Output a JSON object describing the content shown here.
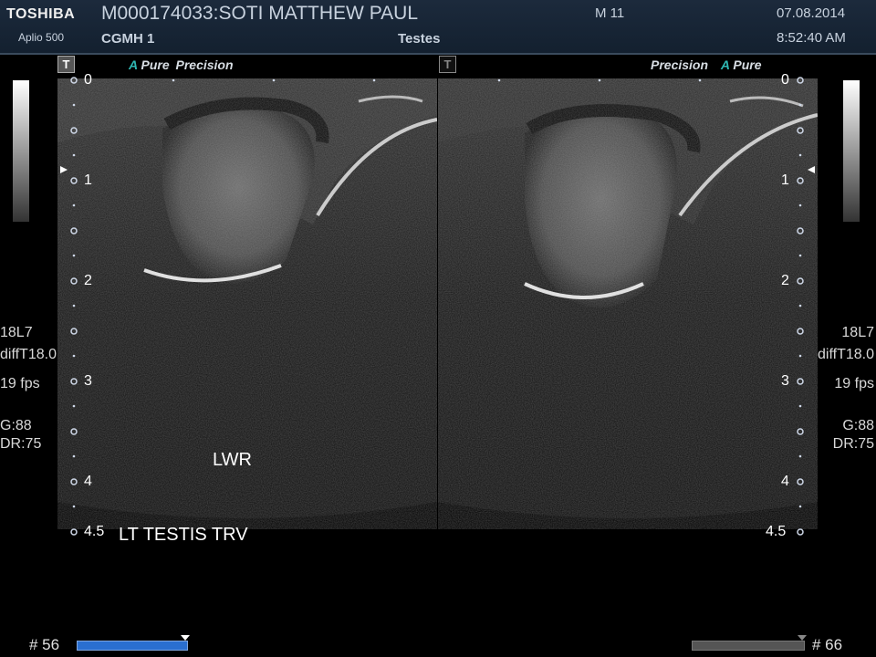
{
  "header": {
    "brand": "TOSHIBA",
    "model": "Aplio 500",
    "patient": "M000174033:SOTI MATTHEW PAUL",
    "hospital": "CGMH 1",
    "exam": "Testes",
    "mode_m": "M 11",
    "date": "07.08.2014",
    "time": "8:52:40 AM"
  },
  "left_panel": {
    "t_label": "T",
    "mode_a": "A",
    "mode_pure": "Pure",
    "mode_precision": "Precision",
    "depth_labels": [
      "0",
      "1",
      "2",
      "3",
      "4",
      "4.5"
    ],
    "annotation_lwr": "LWR",
    "annotation_title": "LT TESTIS TRV",
    "frame": "# 56",
    "cine_progress": 1.0
  },
  "right_panel": {
    "t_label": "T",
    "mode_precision": "Precision",
    "mode_a": "A",
    "mode_pure": "Pure",
    "depth_labels": [
      "0",
      "1",
      "2",
      "3",
      "4",
      "4.5"
    ],
    "frame": "# 66",
    "cine_progress": 1.0
  },
  "params_left": {
    "probe": "18L7",
    "filter": "diffT18.0",
    "fps": "19 fps",
    "gain": "G:88",
    "dr": "DR:75"
  },
  "params_right": {
    "probe": "18L7",
    "filter": "diffT18.0",
    "fps": "19 fps",
    "gain": "G:88",
    "dr": "DR:75"
  }
}
